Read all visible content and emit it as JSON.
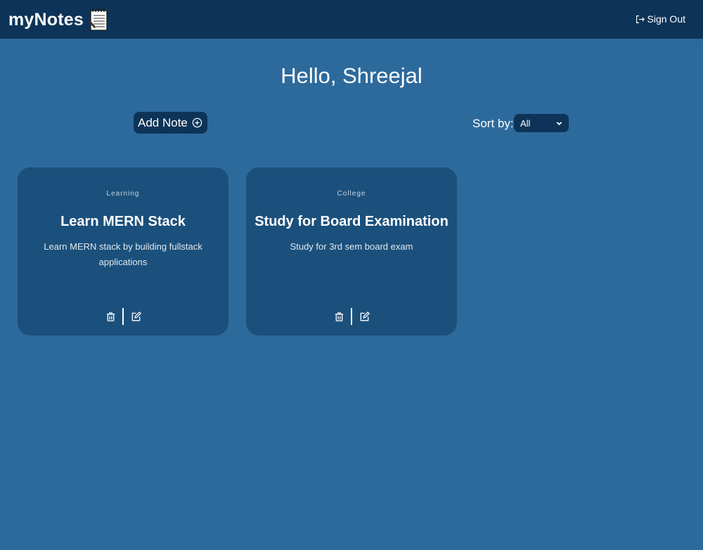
{
  "navbar": {
    "brand": "myNotes",
    "brand_icon": "notepad-icon",
    "signout_label": "Sign Out",
    "signout_icon": "sign-out-icon"
  },
  "greeting": "Hello, Shreejal",
  "toolbar": {
    "add_note_label": "Add Note",
    "add_note_icon": "plus-circle-icon",
    "sort_label": "Sort by:",
    "sort_value": "All"
  },
  "notes": [
    {
      "tag": "Learning",
      "title": "Learn MERN Stack",
      "description": "Learn MERN stack by building fullstack applications"
    },
    {
      "tag": "College",
      "title": "Study for Board Examination",
      "description": "Study for 3rd sem board exam"
    }
  ],
  "colors": {
    "background": "#2d6a9c",
    "navbar": "#0d3458",
    "card": "#1b507c"
  }
}
